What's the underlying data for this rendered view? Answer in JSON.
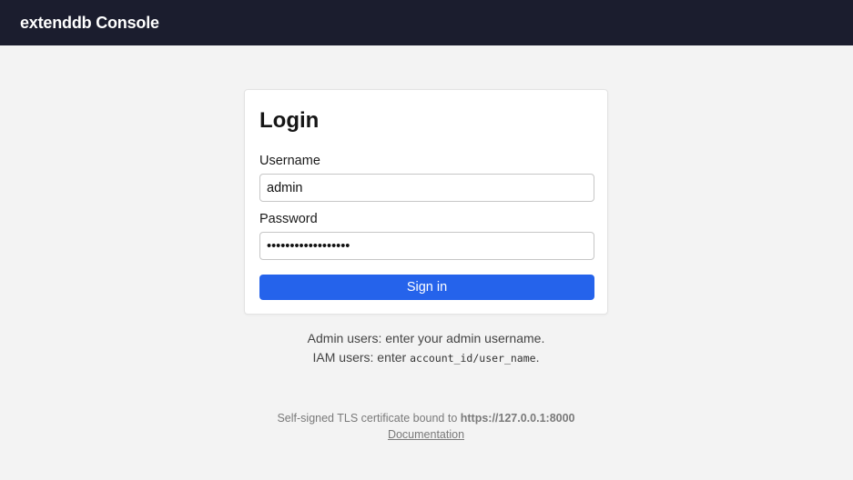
{
  "header": {
    "title": "extenddb Console"
  },
  "login": {
    "heading": "Login",
    "username_label": "Username",
    "username_value": "admin",
    "password_label": "Password",
    "password_value": "••••••••••••••••••",
    "submit_label": "Sign in"
  },
  "hints": {
    "admin": "Admin users: enter your admin username.",
    "iam_prefix": "IAM users: enter ",
    "iam_code": "account_id/user_name",
    "iam_suffix": "."
  },
  "footer": {
    "tls_prefix": "Self-signed TLS certificate bound to ",
    "tls_url": "https://127.0.0.1:8000",
    "docs_link": "Documentation"
  },
  "colors": {
    "topbar": "#1b1d2e",
    "accent": "#2563eb",
    "background": "#f3f3f3"
  }
}
